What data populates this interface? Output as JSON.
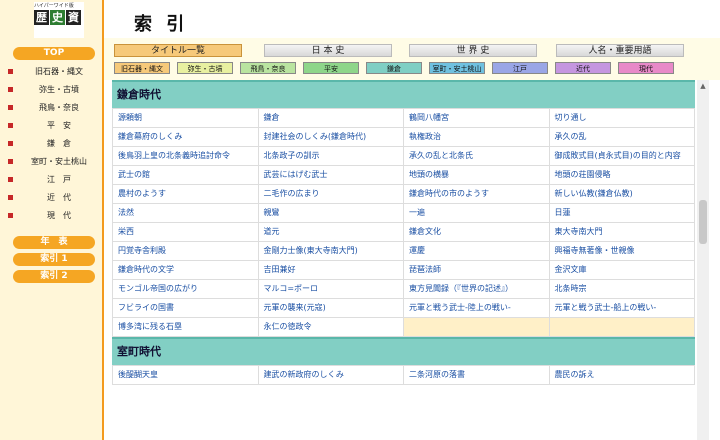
{
  "logo": {
    "small_text": "ハイパーワイド版",
    "chars": [
      "歴",
      "史",
      "資",
      "料",
      "集"
    ]
  },
  "sidebar": {
    "top_label": "TOP",
    "eras": [
      "旧石器・縄文",
      "弥生・古墳",
      "飛鳥・奈良",
      "平　安",
      "鎌　倉",
      "室町・安土桃山",
      "江　戸",
      "近　代",
      "現　代"
    ],
    "nenpyo_label": "年　表",
    "index1_label": "索引 1",
    "index2_label": "索引 2"
  },
  "header": {
    "title": "索 引"
  },
  "tabs": [
    {
      "label": "タイトル一覧",
      "active": true
    },
    {
      "label": "日 本 史",
      "active": false
    },
    {
      "label": "世 界 史",
      "active": false
    },
    {
      "label": "人名・重要用語",
      "active": false
    }
  ],
  "era_tabs": [
    {
      "label": "旧石器・縄文",
      "color": "#f6c97a"
    },
    {
      "label": "弥生・古墳",
      "color": "#e8f0a0"
    },
    {
      "label": "飛鳥・奈良",
      "color": "#b9e4a0"
    },
    {
      "label": "平安",
      "color": "#8ed68a"
    },
    {
      "label": "鎌倉",
      "color": "#7fcfc4"
    },
    {
      "label": "室町・安土桃山",
      "color": "#6fc1e0"
    },
    {
      "label": "江戸",
      "color": "#9aa6e6"
    },
    {
      "label": "近代",
      "color": "#c596e0"
    },
    {
      "label": "現代",
      "color": "#e889c8"
    }
  ],
  "sections": [
    {
      "title": "鎌倉時代",
      "rows": [
        [
          "源頼朝",
          "鎌倉",
          "鶴岡八幡宮",
          "切り通し"
        ],
        [
          "鎌倉幕府のしくみ",
          "封建社会のしくみ(鎌倉時代)",
          "執権政治",
          "承久の乱"
        ],
        [
          "後鳥羽上皇の北条義時追討命令",
          "北条政子の訓示",
          "承久の乱と北条氏",
          "御成敗式目(貞永式目)の目的と内容"
        ],
        [
          "武士の館",
          "武芸にはげむ武士",
          "地頭の横暴",
          "地頭の荘園侵略"
        ],
        [
          "農村のようす",
          "二毛作の広まり",
          "鎌倉時代の市のようす",
          "新しい仏教(鎌倉仏教)"
        ],
        [
          "法然",
          "親鸞",
          "一遍",
          "日蓮"
        ],
        [
          "栄西",
          "道元",
          "鎌倉文化",
          "東大寺南大門"
        ],
        [
          "円覚寺舎利殿",
          "金剛力士像(東大寺南大門)",
          "運慶",
          "興福寺無著像・世親像"
        ],
        [
          "鎌倉時代の文学",
          "吉田兼好",
          "琵琶法師",
          "金沢文庫"
        ],
        [
          "モンゴル帝国の広がり",
          "マルコ=ポーロ",
          "東方見聞録（『世界の記述』）",
          "北条時宗"
        ],
        [
          "フビライの国書",
          "元軍の襲来(元寇)",
          "元軍と戦う武士-陸上の戦い-",
          "元軍と戦う武士-船上の戦い-"
        ],
        [
          "博多湾に残る石塁",
          "永仁の徳政令",
          "",
          ""
        ]
      ]
    },
    {
      "title": "室町時代",
      "rows": [
        [
          "後醍醐天皇",
          "建武の新政府のしくみ",
          "二条河原の落書",
          "農民の訴え"
        ]
      ]
    }
  ],
  "scroll_up_glyph": "▲"
}
